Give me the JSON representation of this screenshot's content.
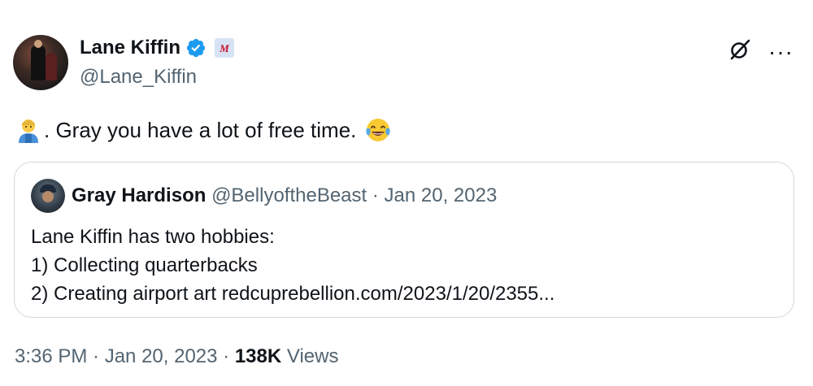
{
  "author": {
    "name": "Lane Kiffin",
    "handle": "@Lane_Kiffin",
    "verified": true,
    "verified_color": "#1d9bf0",
    "badge_icon": "ole-miss-logo-icon"
  },
  "tweet": {
    "text": ". Gray you have a lot of free time.",
    "leading_emoji": "farmer-emoji-icon",
    "trailing_emoji": "tears-of-joy-emoji-icon"
  },
  "quote": {
    "name": "Gray Hardison",
    "meta": "@BellyoftheBeast · Jan 20, 2023",
    "lines": [
      "Lane Kiffin has two hobbies:",
      "1) Collecting quarterbacks",
      "2) Creating airport art redcuprebellion.com/2023/1/20/2355..."
    ]
  },
  "footer": {
    "timestamp": "3:36 PM · Jan 20, 2023 · ",
    "views_count": "138K",
    "views_label": " Views"
  },
  "colors": {
    "text": "#0f1419",
    "secondary": "#536471",
    "border": "#cfd9de"
  }
}
